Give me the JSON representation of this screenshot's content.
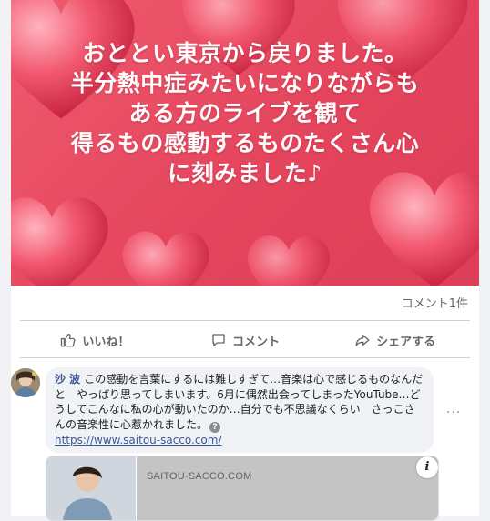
{
  "post": {
    "image_text_lines": [
      "おととい東京から戻りました。",
      "半分熱中症みたいになりながらも",
      "ある方のライブを観て",
      "得るもの感動するものたくさん心",
      "に刻みました♪"
    ],
    "comment_count": "コメント1件"
  },
  "actions": {
    "like": "いいね！",
    "comment": "コメント",
    "share": "シェアする"
  },
  "comment": {
    "author": "沙 波",
    "text": "この感動を言葉にするには難しすぎて…音楽は心で感じるものなんだと　やっぱり思ってしまいます。6月に偶然出会ってしまったYouTube…どうしてこんなに私の心が動いたのか…自分でも不思議なくらい　さっこさんの音楽性に心惹かれました。",
    "link": "https://www.saitou-sacco.com/"
  },
  "link_preview": {
    "domain": "SAITOU-SACCO.COM"
  },
  "colors": {
    "hero": "#e4455d",
    "link": "#385898",
    "muted": "#65676b"
  }
}
